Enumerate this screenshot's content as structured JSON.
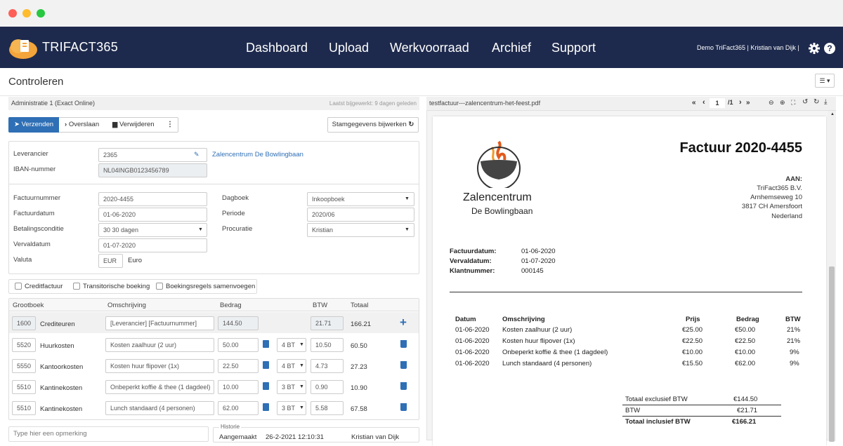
{
  "app": {
    "logo_text": "TRIFACT365"
  },
  "nav": [
    "Dashboard",
    "Upload",
    "Werkvoorraad",
    "Archief",
    "Support"
  ],
  "user": {
    "text": "Demo TriFact365 | Kristian van Dijk |"
  },
  "page": {
    "title": "Controleren"
  },
  "admin": {
    "name": "Administratie 1 (Exact Online)",
    "updated": "Laatst bijgewerkt: 9 dagen geleden"
  },
  "toolbar": {
    "send": "Verzenden",
    "skip": "Overslaan",
    "delete": "Verwijderen",
    "more": "⋮",
    "refresh": "Stamgegevens bijwerken"
  },
  "form": {
    "leverancier_label": "Leverancier",
    "leverancier_value": "2365",
    "leverancier_name": "Zalencentrum De Bowlingbaan",
    "iban_label": "IBAN-nummer",
    "iban_value": "NL04INGB0123456789",
    "factuurnummer_label": "Factuurnummer",
    "factuurnummer_value": "2020-4455",
    "factuurdatum_label": "Factuurdatum",
    "factuurdatum_value": "01-06-2020",
    "betalingsconditie_label": "Betalingsconditie",
    "betalingsconditie_value": "30 30 dagen",
    "vervaldatum_label": "Vervaldatum",
    "vervaldatum_value": "01-07-2020",
    "valuta_label": "Valuta",
    "valuta_code": "EUR",
    "valuta_name": "Euro",
    "dagboek_label": "Dagboek",
    "dagboek_value": "Inkoopboek",
    "periode_label": "Periode",
    "periode_value": "2020/06",
    "procuratie_label": "Procuratie",
    "procuratie_value": "Kristian"
  },
  "checkboxes": [
    "Creditfactuur",
    "Transitorische boeking",
    "Boekingsregels samenvoegen"
  ],
  "table": {
    "headers": [
      "Grootboek",
      "Omschrijving",
      "Bedrag",
      "BTW",
      "Totaal"
    ],
    "rows": [
      {
        "code": "1600",
        "name": "Crediteuren",
        "desc": "[Leverancier] [Factuurnummer]",
        "amount": "144.50",
        "vat_code": "",
        "btw": "21.71",
        "total": "166.21"
      },
      {
        "code": "5520",
        "name": "Huurkosten",
        "desc": "Kosten zaalhuur (2 uur)",
        "amount": "50.00",
        "vat_code": "4 BT",
        "btw": "10.50",
        "total": "60.50"
      },
      {
        "code": "5550",
        "name": "Kantoorkosten",
        "desc": "Kosten huur flipover (1x)",
        "amount": "22.50",
        "vat_code": "4 BT",
        "btw": "4.73",
        "total": "27.23"
      },
      {
        "code": "5510",
        "name": "Kantinekosten",
        "desc": "Onbeperkt koffie & thee (1 dagdeel)",
        "amount": "10.00",
        "vat_code": "3 BT",
        "btw": "0.90",
        "total": "10.90"
      },
      {
        "code": "5510",
        "name": "Kantinekosten",
        "desc": "Lunch standaard (4 personen)",
        "amount": "62.00",
        "vat_code": "3 BT",
        "btw": "5.58",
        "total": "67.58"
      }
    ]
  },
  "remark": {
    "placeholder": "Type hier een opmerking"
  },
  "history": {
    "title": "Historie",
    "action": "Aangemaakt",
    "datetime": "26-2-2021 12:10:31",
    "user": "Kristian van Dijk"
  },
  "pdf": {
    "filename": "testfactuur---zalencentrum-het-feest.pdf",
    "nav_first": "«",
    "nav_prev": "‹",
    "page": "1",
    "pages": "/1",
    "nav_next": "›",
    "nav_last": "»",
    "invoice_title": "Factuur 2020-4455",
    "company_line1": "Zalencentrum",
    "company_line2": "De Bowlingbaan",
    "to_label": "AAN:",
    "to_lines": [
      "TriFact365 B.V.",
      "Arnhemseweg 10",
      "3817 CH  Amersfoort",
      "Nederland"
    ],
    "meta": [
      {
        "label": "Factuurdatum:",
        "value": "01-06-2020"
      },
      {
        "label": "Vervaldatum:",
        "value": "01-07-2020"
      },
      {
        "label": "Klantnummer:",
        "value": "000145"
      }
    ],
    "headers": [
      "Datum",
      "Omschrijving",
      "Prijs",
      "Bedrag",
      "BTW"
    ],
    "rows": [
      {
        "date": "01-06-2020",
        "desc": "Kosten zaalhuur (2 uur)",
        "price": "€25.00",
        "amount": "€50.00",
        "vat": "21%"
      },
      {
        "date": "01-06-2020",
        "desc": "Kosten huur flipover (1x)",
        "price": "€22.50",
        "amount": "€22.50",
        "vat": "21%"
      },
      {
        "date": "01-06-2020",
        "desc": "Onbeperkt koffie & thee (1 dagdeel)",
        "price": "€10.00",
        "amount": "€10.00",
        "vat": "9%"
      },
      {
        "date": "01-06-2020",
        "desc": "Lunch standaard (4 personen)",
        "price": "€15.50",
        "amount": "€62.00",
        "vat": "9%"
      }
    ],
    "totals": [
      {
        "label": "Totaal exclusief BTW",
        "value": "€144.50"
      },
      {
        "label": "BTW",
        "value": "€21.71"
      },
      {
        "label": "Totaal inclusief BTW",
        "value": "€166.21"
      }
    ]
  },
  "colors": {
    "navy": "#1e2a4d",
    "primary": "#2f6fb5",
    "orange": "#f3a43a"
  }
}
